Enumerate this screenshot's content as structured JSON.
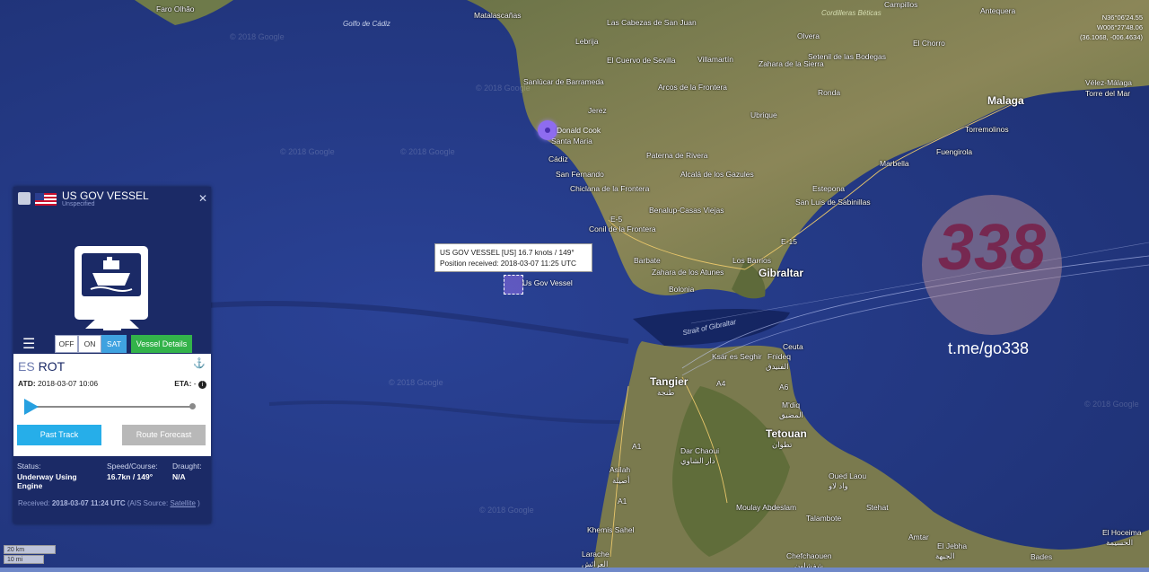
{
  "panel": {
    "vessel_name": "US GOV VESSEL",
    "vessel_type": "Unspecified",
    "ais_toggle": {
      "off": "OFF",
      "on": "ON",
      "sat": "SAT"
    },
    "vessel_details": "Vessel Details",
    "destination_country": "ES",
    "destination": "ROT",
    "atd_label": "ATD:",
    "atd_value": "2018-03-07 10:06",
    "eta_label": "ETA:",
    "eta_value": "-",
    "past_track": "Past Track",
    "route_forecast": "Route Forecast",
    "status_label": "Status:",
    "status_value": "Underway Using Engine",
    "speed_label": "Speed/Course:",
    "speed_value": "16.7kn / 149°",
    "draught_label": "Draught:",
    "draught_value": "N/A",
    "received_label": "Received:",
    "received_value": "2018-03-07 11:24 UTC",
    "ais_source_prefix": "(AIS Source:",
    "ais_source_value": "Satellite",
    "ais_source_suffix": ")"
  },
  "map": {
    "tooltip_line1": "US GOV VESSEL [US] 16.7 knots / 149°",
    "tooltip_line2": "Position received: 2018-03-07 11:25 UTC",
    "vessel_label": "Us Gov Vessel",
    "other_vessel_label": "Donald Cook",
    "labels": {
      "faro": "Faro Olhão",
      "golfo": "Golfo de Cádiz",
      "matalascanas": "Matalascañas",
      "cabezas": "Las Cabezas de San Juan",
      "lebrija": "Lebrija",
      "sanlucar": "Sanlúcar de Barrameda",
      "elcuervo": "El Cuervo de Sevilla",
      "jerez": "Jerez",
      "santamaria": "Santa Maria",
      "cadiz": "Cádiz",
      "sanfernando": "San Fernando",
      "chiclana": "Chiclana de la Frontera",
      "conil": "Conil de la Frontera",
      "barbate": "Barbate",
      "zahara": "Zahara de los Atunes",
      "bolonia": "Bolonia",
      "arcos": "Arcos de la Frontera",
      "villamartin": "Villamartín",
      "ubrique": "Ubrique",
      "ronda": "Ronda",
      "paterna": "Paterna de Rivera",
      "alcala": "Alcalá de los Gazules",
      "benalup": "Benalup-Casas Viejas",
      "losbarrios": "Los Barrios",
      "gibraltar": "Gibraltar",
      "estepona": "Estepona",
      "marbella": "Marbella",
      "fuengirola": "Fuengirola",
      "torremolinos": "Torremolinos",
      "malaga": "Malaga",
      "velez": "Vélez-Málaga",
      "torredelmar": "Torre del Mar",
      "antequera": "Antequera",
      "elchorro": "El Chorro",
      "campillos": "Campillos",
      "cordilleras": "Cordilleras Béticas",
      "olvera": "Olvera",
      "zahara_sierra": "Zahara de la Sierra",
      "setenil": "Setenil de las Bodegas",
      "sanroque": "San Luis de Sabinillas",
      "strait": "Strait of Gibraltar",
      "ceuta": "Ceuta",
      "tangier": "Tangier",
      "tangier_ar": "طنجة",
      "ksar": "Ksar es Seghir",
      "fnideq": "Fnideq",
      "fnideq_ar": "الفنيدق",
      "mdiq": "M'diq",
      "mdiq_ar": "المضيق",
      "tetouan": "Tetouan",
      "tetouan_ar": "تطوان",
      "asilah": "Asilah",
      "asilah_ar": "أصيلة",
      "darchaoui": "Dar Chaoui",
      "darchaoui_ar": "دار الشاوي",
      "oudlaou": "Oued Laou",
      "oudlaou_ar": "واد لاو",
      "moulay": "Moulay Abdeslam",
      "talambote": "Talambote",
      "khemis": "Khemis Sahel",
      "larache": "Larache",
      "larache_ar": "العرائش",
      "chefchaouen": "Chefchaouen",
      "chefchaouen_ar": "شفشاون",
      "stehat": "Stehat",
      "amtar": "Amtar",
      "eljebha": "El Jebha",
      "eljebha_ar": "الجبهة",
      "badis": "Bades",
      "elhoceima": "El Hoceima",
      "elhoceima_ar": "الحسيمة",
      "a1": "A1",
      "a4": "A4",
      "a6": "A6",
      "e15": "E-15",
      "e5": "E-5"
    },
    "coords": {
      "lat": "N36°06'24.55",
      "lon": "W006°27'48.06",
      "decimal": "(36.1068, -006.4634)"
    },
    "scale_km": "20 km",
    "scale_mi": "10 mi",
    "watermark_google": "© 2018 Google"
  },
  "watermark": {
    "number": "338",
    "channel": "t.me/go338"
  }
}
